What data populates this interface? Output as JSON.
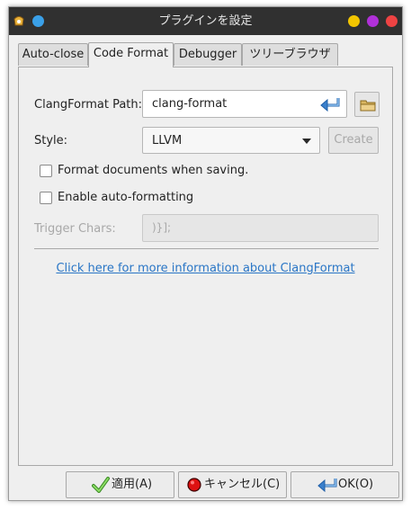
{
  "window": {
    "title": "プラグインを設定",
    "controls": {
      "yellow": "#f2c500",
      "purple": "#b030d8",
      "red": "#ee4343",
      "blue": "#3aa0e8"
    }
  },
  "tabs": [
    {
      "label": "Auto-close",
      "active": false
    },
    {
      "label": "Code Format",
      "active": true
    },
    {
      "label": "Debugger",
      "active": false
    },
    {
      "label": "ツリーブラウザ",
      "active": false
    }
  ],
  "form": {
    "path_label": "ClangFormat Path:",
    "path_value": "clang-format",
    "style_label": "Style:",
    "style_value": "LLVM",
    "create_label": "Create",
    "format_on_save_label": "Format documents when saving.",
    "format_on_save_checked": false,
    "auto_format_label": "Enable auto-formatting",
    "auto_format_checked": false,
    "trigger_label": "Trigger Chars:",
    "trigger_value": ")}];",
    "info_link": "Click here for more information about ClangFormat"
  },
  "buttons": {
    "apply": "適用(A)",
    "cancel": "キャンセル(C)",
    "ok": "OK(O)"
  },
  "icons": {
    "path_clear": "undo-arrow-icon",
    "browse": "folder-icon",
    "dropdown": "triangle-down-icon",
    "apply": "checkmark-icon",
    "cancel": "red-circle-icon",
    "ok": "return-arrow-icon"
  },
  "colors": {
    "link": "#2a76c6",
    "accent_check": "#6cc24a",
    "cancel_red": "#dd1111"
  }
}
